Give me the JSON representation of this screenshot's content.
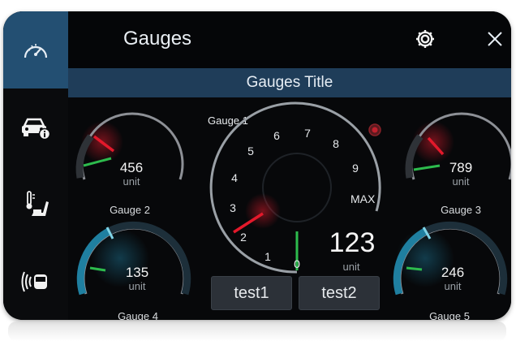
{
  "header": {
    "title": "Gauges"
  },
  "title_bar": {
    "text": "Gauges Title"
  },
  "sidebar": {
    "items": [
      {
        "icon": "speedometer-icon",
        "active": true
      },
      {
        "icon": "car-info-icon",
        "active": false
      },
      {
        "icon": "seat-temperature-icon",
        "active": false
      },
      {
        "icon": "vehicle-sensor-icon",
        "active": false
      }
    ]
  },
  "colors": {
    "accent": "#234f72",
    "needle": "#e0192b",
    "green": "#29b34a",
    "teal": "#2a8fb0"
  },
  "gauges": {
    "g1": {
      "label": "Gauge 1",
      "value": "123",
      "unit": "unit",
      "max_label": "MAX",
      "scale": [
        "0",
        "1",
        "2",
        "3",
        "4",
        "5",
        "6",
        "7",
        "8",
        "9"
      ]
    },
    "g2": {
      "label": "Gauge 2",
      "value": "456",
      "unit": "unit"
    },
    "g3": {
      "label": "Gauge 3",
      "value": "789",
      "unit": "unit"
    },
    "g4": {
      "label": "Gauge 4",
      "value": "135",
      "unit": "unit"
    },
    "g5": {
      "label": "Gauge 5",
      "value": "246",
      "unit": "unit"
    }
  },
  "buttons": {
    "test1": "test1",
    "test2": "test2"
  }
}
